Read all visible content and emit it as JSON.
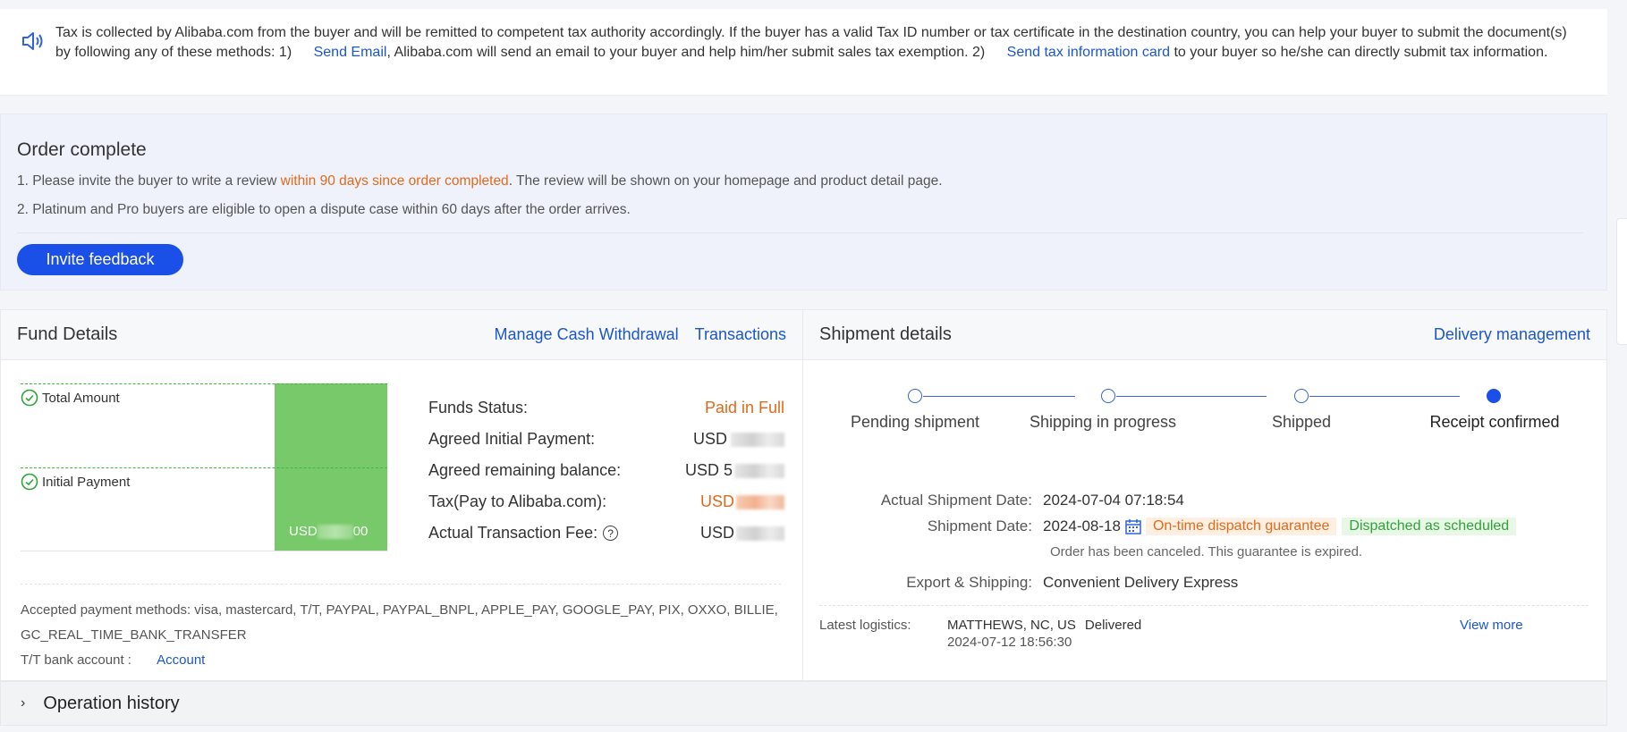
{
  "notice": {
    "icon": "speaker-icon",
    "text_1": "Tax is collected by Alibaba.com from the buyer and will be remitted to competent tax authority accordingly. If the buyer has a valid Tax ID number or tax certificate in the destination country, you can help your buyer to submit the document(s) by following any of these methods: 1)",
    "link_email": "Send Email",
    "text_2": ", Alibaba.com will send an email to your buyer and help him/her submit sales tax exemption. 2)",
    "link_card": "Send tax information card",
    "text_3": " to your buyer so he/she can directly submit tax information."
  },
  "order": {
    "title": "Order complete",
    "line1_prefix": "1. Please invite the buyer to write a review ",
    "line1_highlight": "within 90 days since order completed",
    "line1_suffix": ". The review will be shown on your homepage and product detail page.",
    "line2": "2. Platinum and Pro buyers are eligible to open a dispute case within 60 days after the order arrives.",
    "button": "Invite feedback"
  },
  "fund": {
    "title": "Fund Details",
    "links": [
      "Manage Cash Withdrawal",
      "Transactions"
    ],
    "legend": [
      "Total Amount",
      "Initial Payment"
    ],
    "bar_label_prefix": "USD",
    "bar_label_suffix": "00",
    "rows": [
      {
        "label": "Funds Status:",
        "value": "Paid in Full"
      },
      {
        "label": "Agreed Initial Payment:",
        "value": "USD"
      },
      {
        "label": "Agreed remaining balance:",
        "value": "USD 5"
      },
      {
        "label": "Tax(Pay to Alibaba.com):",
        "value": "USD"
      },
      {
        "label": "Actual Transaction Fee:",
        "value": "USD"
      }
    ],
    "payment_methods": "Accepted payment methods: visa, mastercard, T/T, PAYPAL, PAYPAL_BNPL, APPLE_PAY, GOOGLE_PAY, PIX, OXXO, BILLIE, GC_REAL_TIME_BANK_TRANSFER",
    "tt_label": "T/T bank account :",
    "tt_link": "Account"
  },
  "shipment": {
    "title": "Shipment details",
    "link": "Delivery management",
    "steps": [
      "Pending shipment",
      "Shipping in progress",
      "Shipped",
      "Receipt confirmed"
    ],
    "active_step": 3,
    "actual_date_label": "Actual Shipment Date:",
    "actual_date": "2024-07-04 07:18:54",
    "ship_date_label": "Shipment Date:",
    "ship_date": "2024-08-18",
    "tag_guarantee": "On-time dispatch guarantee",
    "tag_dispatched": "Dispatched as scheduled",
    "note": "Order has been canceled. This guarantee is expired.",
    "export_label": "Export & Shipping:",
    "export_value": "Convenient Delivery Express",
    "logistics_label": "Latest logistics:",
    "logistics_location": "MATTHEWS, NC, US",
    "logistics_status": "Delivered",
    "logistics_time": "2024-07-12 18:56:30",
    "view_more": "View more"
  },
  "history": {
    "title": "Operation history"
  },
  "colors": {
    "accent": "#1a4fe8",
    "link": "#1c56cc",
    "orange": "#e06a1b",
    "green": "#2fa339",
    "bar": "#77c96a"
  }
}
